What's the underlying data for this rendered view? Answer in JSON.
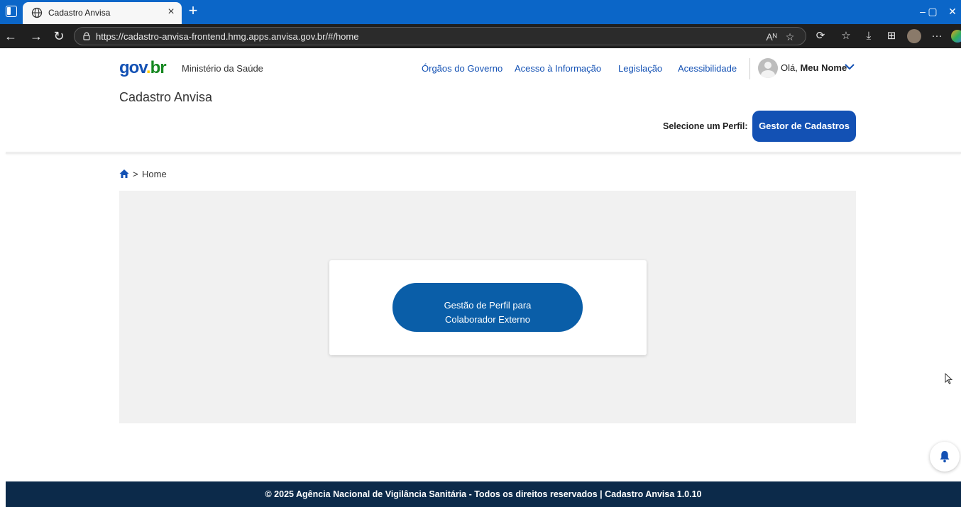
{
  "browser": {
    "tab_title": "Cadastro Anvisa",
    "tab_close": "×",
    "new_tab": "+",
    "url": "https://cadastro-anvisa-frontend.hmg.apps.anvisa.gov.br/#/home",
    "read_aloud": "Aᴺ",
    "controls": {
      "minimize": "–",
      "maximize": "▢",
      "close": "✕"
    }
  },
  "header": {
    "logo_parts": [
      "gov",
      ".",
      "br"
    ],
    "ministry": "Ministério da Saúde",
    "links": [
      "Órgãos do Governo",
      "Acesso à Informação",
      "Legislação",
      "Acessibilidade"
    ],
    "greeting": "Olá,",
    "user_name": "Meu Nome",
    "app_title": "Cadastro Anvisa",
    "profile_label": "Selecione um Perfil:",
    "profile_button": "Gestor de Cadastros"
  },
  "breadcrumb": {
    "separator": ">",
    "current": "Home"
  },
  "main": {
    "card_button_line1": "Gestão de Perfil para",
    "card_button_line2": "Colaborador Externo"
  },
  "footer": {
    "text": "© 2025 Agência Nacional de Vigilância Sanitária - Todos os direitos reservados | Cadastro Anvisa 1.0.10"
  },
  "colors": {
    "brand_blue": "#1351b4",
    "card_button": "#0a5ea8",
    "footer_bg": "#0c2a4a",
    "browser_tabbar": "#0b66c8"
  }
}
